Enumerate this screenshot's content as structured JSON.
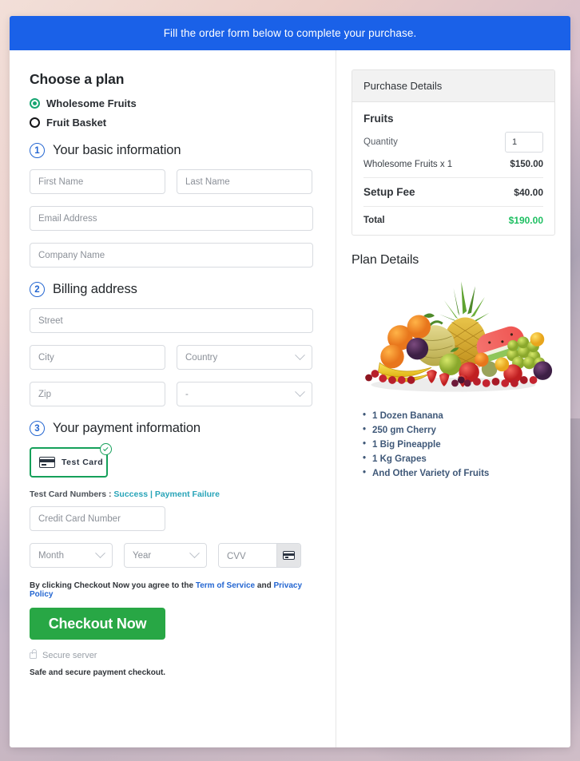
{
  "banner": {
    "text": "Fill the order form below to complete your purchase."
  },
  "plan": {
    "heading": "Choose a plan",
    "options": [
      {
        "label": "Wholesome Fruits",
        "selected": true
      },
      {
        "label": "Fruit Basket",
        "selected": false
      }
    ]
  },
  "steps": [
    {
      "number": "1",
      "title": "Your basic information"
    },
    {
      "number": "2",
      "title": "Billing address"
    },
    {
      "number": "3",
      "title": "Your payment information"
    }
  ],
  "basic_info": {
    "first_name_placeholder": "First Name",
    "last_name_placeholder": "Last Name",
    "email_placeholder": "Email Address",
    "company_placeholder": "Company Name"
  },
  "billing": {
    "street_placeholder": "Street",
    "city_placeholder": "City",
    "country_placeholder": "Country",
    "zip_placeholder": "Zip",
    "state_placeholder": "-"
  },
  "payment": {
    "card_tile_label": "Test  Card",
    "test_numbers_prefix": "Test Card Numbers :",
    "success_link": "Success",
    "separator": "|",
    "failure_link": "Payment Failure",
    "card_number_placeholder": "Credit Card Number",
    "month_placeholder": "Month",
    "year_placeholder": "Year",
    "cvv_placeholder": "CVV"
  },
  "footer": {
    "terms_prefix": "By clicking Checkout Now you agree to the",
    "terms_link": "Term of Service",
    "terms_and": "and",
    "privacy_link": "Privacy Policy",
    "checkout_label": "Checkout Now",
    "secure_server": "Secure server",
    "safe_note": "Safe and secure payment checkout."
  },
  "purchase_details": {
    "header": "Purchase Details",
    "product_title": "Fruits",
    "quantity_label": "Quantity",
    "quantity_value": "1",
    "item_label": "Wholesome Fruits x 1",
    "item_amount": "$150.00",
    "setup_fee_label": "Setup Fee",
    "setup_fee_amount": "$40.00",
    "total_label": "Total",
    "total_amount": "$190.00"
  },
  "plan_details": {
    "heading": "Plan Details",
    "items": [
      "1 Dozen Banana",
      " 250 gm Cherry",
      "1 Big Pineapple",
      "1 Kg Grapes",
      "And Other Variety of Fruits"
    ]
  },
  "colors": {
    "banner_blue": "#1a61e8",
    "accent_green": "#28a745",
    "total_green": "#1fbf62",
    "link_blue": "#2466d1",
    "link_teal": "#28a4b8",
    "step_blue": "#2466d1"
  }
}
